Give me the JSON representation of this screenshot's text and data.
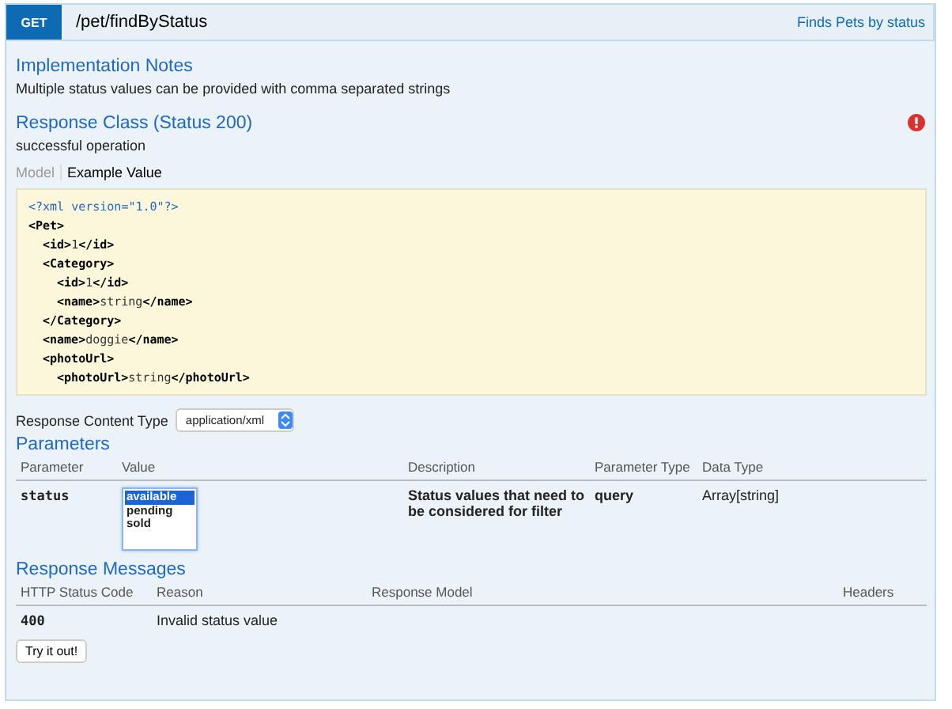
{
  "header": {
    "method": "GET",
    "path": "/pet/findByStatus",
    "summary": "Finds Pets by status"
  },
  "implementation_notes": {
    "title": "Implementation Notes",
    "text": "Multiple status values can be provided with comma separated strings"
  },
  "response_class": {
    "title": "Response Class (Status 200)",
    "text": "successful operation",
    "error_icon": true
  },
  "model_tabs": [
    {
      "label": "Model",
      "selected": false
    },
    {
      "label": "Example Value",
      "selected": true
    }
  ],
  "example": {
    "declaration": "<?xml version=\"1.0\"?>",
    "root": {
      "open": "<Pet>",
      "children": [
        {
          "open": "<id>",
          "text": "1",
          "close": "</id>"
        },
        {
          "open": "<Category>",
          "children": [
            {
              "open": "<id>",
              "text": "1",
              "close": "</id>"
            },
            {
              "open": "<name>",
              "text": "string",
              "close": "</name>"
            }
          ],
          "close": "</Category>"
        },
        {
          "open": "<name>",
          "text": "doggie",
          "close": "</name>"
        },
        {
          "open": "<photoUrl>",
          "children": [
            {
              "open": "<photoUrl>",
              "text": "string",
              "close": "</photoUrl>"
            }
          ]
        }
      ]
    }
  },
  "response_content_type": {
    "label": "Response Content Type",
    "value": "application/xml"
  },
  "parameters": {
    "title": "Parameters",
    "columns": [
      "Parameter",
      "Value",
      "Description",
      "Parameter Type",
      "Data Type"
    ],
    "rows": [
      {
        "name": "status",
        "options": [
          {
            "label": "available",
            "selected": true
          },
          {
            "label": "pending",
            "selected": false
          },
          {
            "label": "sold",
            "selected": false
          }
        ],
        "description": "Status values that need to be considered for filter",
        "parameter_type": "query",
        "data_type": "Array[string]"
      }
    ]
  },
  "response_messages": {
    "title": "Response Messages",
    "columns": [
      "HTTP Status Code",
      "Reason",
      "Response Model",
      "Headers"
    ],
    "rows": [
      {
        "code": "400",
        "reason": "Invalid status value"
      }
    ]
  },
  "try_button": "Try it out!"
}
